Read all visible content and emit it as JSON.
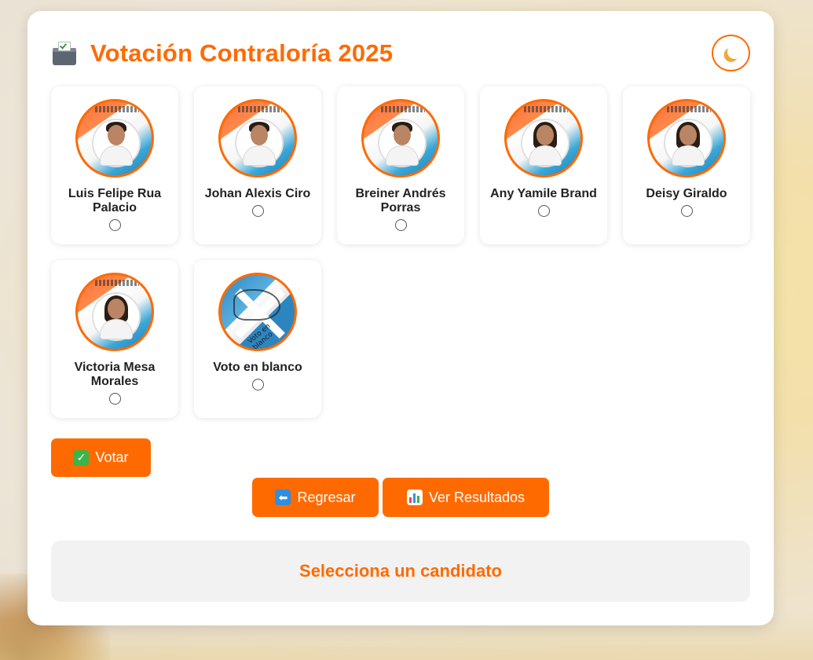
{
  "header": {
    "title": "Votación Contraloría 2025",
    "icon": "ballot-box-icon"
  },
  "theme_toggle": {
    "icon": "moon-icon"
  },
  "candidates": [
    {
      "name": "Luis Felipe Rua Palacio",
      "photo": "candidate-photo"
    },
    {
      "name": "Johan Alexis Ciro",
      "photo": "candidate-photo"
    },
    {
      "name": "Breiner Andrés Porras",
      "photo": "candidate-photo"
    },
    {
      "name": "Any Yamile Brand",
      "photo": "candidate-photo"
    },
    {
      "name": "Deisy Giraldo",
      "photo": "candidate-photo"
    },
    {
      "name": "Victoria Mesa Morales",
      "photo": "candidate-photo"
    },
    {
      "name": "Voto en blanco",
      "photo": "blank-vote-photo",
      "photo_text": "Voto en blanco"
    }
  ],
  "buttons": {
    "vote_label": "Votar",
    "back_label": "Regresar",
    "results_label": "Ver Resultados"
  },
  "status": {
    "message": "Selecciona un candidato"
  },
  "colors": {
    "accent": "#ff6a00",
    "card_bg": "#ffffff",
    "status_bg": "#f2f2f2"
  }
}
